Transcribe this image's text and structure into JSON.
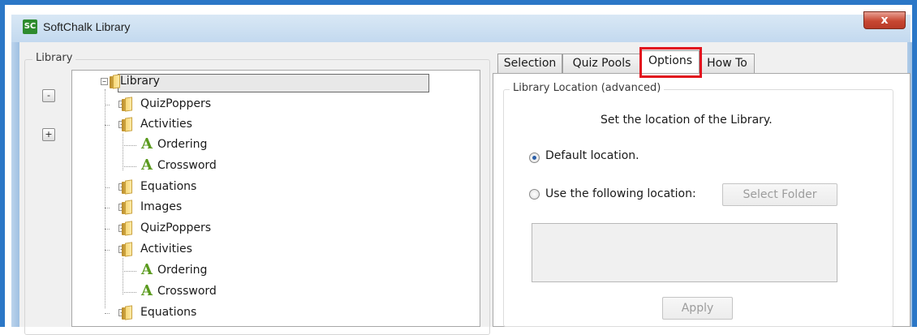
{
  "window": {
    "title": "SoftChalk Library",
    "icon_text": "SC",
    "close_symbol": "x",
    "close_color": "#c74732"
  },
  "library_panel": {
    "group_label": "Library",
    "collapse_all_symbol": "-",
    "expand_all_symbol": "+",
    "tree": [
      {
        "label": "Library",
        "icon": "folder-icon",
        "expander": "−",
        "selected": true
      },
      {
        "label": "QuizPoppers",
        "icon": "folder-icon",
        "expander": "+"
      },
      {
        "label": "Activities",
        "icon": "folder-icon",
        "expander": "−"
      },
      {
        "label": "Ordering",
        "icon": "activity-icon"
      },
      {
        "label": "Crossword",
        "icon": "activity-icon"
      },
      {
        "label": "Equations",
        "icon": "folder-icon",
        "expander": "+"
      },
      {
        "label": "Images",
        "icon": "folder-icon",
        "expander": "+"
      },
      {
        "label": "QuizPoppers",
        "icon": "folder-icon",
        "expander": "+"
      },
      {
        "label": "Activities",
        "icon": "folder-icon",
        "expander": "−"
      },
      {
        "label": "Ordering",
        "icon": "activity-icon"
      },
      {
        "label": "Crossword",
        "icon": "activity-icon"
      },
      {
        "label": "Equations",
        "icon": "folder-icon",
        "expander": "+"
      }
    ]
  },
  "tabs": [
    {
      "label": "Selection",
      "active": false
    },
    {
      "label": "Quiz Pools",
      "active": false
    },
    {
      "label": "Options",
      "active": true
    },
    {
      "label": "How To",
      "active": false
    }
  ],
  "highlight_color": "#e2141e",
  "options": {
    "group_label": "Library Location (advanced)",
    "description": "Set the location of the Library.",
    "default_location_label": "Default location.",
    "default_location_checked": true,
    "custom_location_label": "Use the following location:",
    "custom_location_checked": false,
    "select_folder_label": "Select Folder",
    "apply_label": "Apply"
  }
}
